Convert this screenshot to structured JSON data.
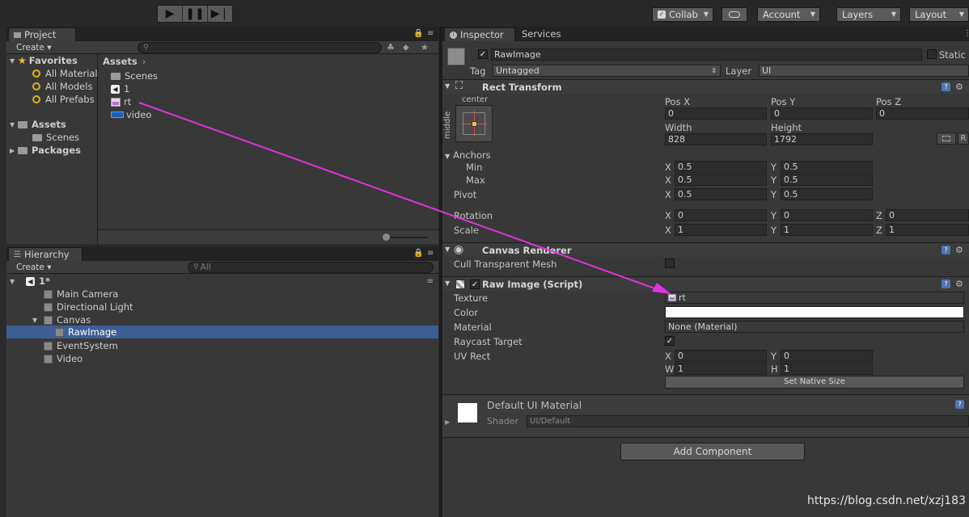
{
  "toolbar": {
    "collab": "Collab",
    "account": "Account",
    "layers": "Layers",
    "layout": "Layout"
  },
  "project": {
    "tab": "Project",
    "create": "Create",
    "favorites": {
      "label": "Favorites",
      "items": [
        "All Material",
        "All Models",
        "All Prefabs"
      ]
    },
    "assets_label": "Assets",
    "assets_child": "Scenes",
    "packages_label": "Packages",
    "breadcrumb": "Assets",
    "files": [
      {
        "name": "Scenes",
        "icon": "folder-icon"
      },
      {
        "name": "1",
        "icon": "unity-scene-icon"
      },
      {
        "name": "rt",
        "icon": "render-texture-icon"
      },
      {
        "name": "video",
        "icon": "video-clip-icon"
      }
    ]
  },
  "hierarchy": {
    "tab": "Hierarchy",
    "create": "Create",
    "search_placeholder": "All",
    "scene": "1*",
    "items": [
      {
        "name": "Main Camera",
        "indent": 1,
        "selected": false
      },
      {
        "name": "Directional Light",
        "indent": 1,
        "selected": false
      },
      {
        "name": "Canvas",
        "indent": 1,
        "selected": false,
        "expanded": true
      },
      {
        "name": "RawImage",
        "indent": 2,
        "selected": true
      },
      {
        "name": "EventSystem",
        "indent": 1,
        "selected": false
      },
      {
        "name": "Video",
        "indent": 1,
        "selected": false
      }
    ]
  },
  "inspector": {
    "tab": "Inspector",
    "tab2": "Services",
    "object_name": "RawImage",
    "static": "Static",
    "tag_label": "Tag",
    "tag_value": "Untagged",
    "layer_label": "Layer",
    "layer_value": "UI",
    "rect_transform": {
      "title": "Rect Transform",
      "anchor_top": "center",
      "anchor_side": "middle",
      "pos_x_label": "Pos X",
      "pos_x": "0",
      "pos_y_label": "Pos Y",
      "pos_y": "0",
      "pos_z_label": "Pos Z",
      "pos_z": "0",
      "width_label": "Width",
      "width": "828",
      "height_label": "Height",
      "height": "1792",
      "anchors": "Anchors",
      "min": "Min",
      "min_x": "0.5",
      "min_y": "0.5",
      "max": "Max",
      "max_x": "0.5",
      "max_y": "0.5",
      "pivot": "Pivot",
      "pivot_x": "0.5",
      "pivot_y": "0.5",
      "rotation": "Rotation",
      "rot_x": "0",
      "rot_y": "0",
      "rot_z": "0",
      "scale": "Scale",
      "scale_x": "1",
      "scale_y": "1",
      "scale_z": "1",
      "x": "X",
      "y": "Y",
      "z": "Z",
      "r": "R"
    },
    "canvas_renderer": {
      "title": "Canvas Renderer",
      "cull": "Cull Transparent Mesh"
    },
    "raw_image": {
      "title": "Raw Image (Script)",
      "texture_label": "Texture",
      "texture": "rt",
      "color_label": "Color",
      "material_label": "Material",
      "material": "None (Material)",
      "raycast_label": "Raycast Target",
      "uvrect_label": "UV Rect",
      "uv_x": "0",
      "uv_y": "0",
      "uv_w": "1",
      "uv_h": "1",
      "w": "W",
      "h": "H",
      "set_native": "Set Native Size"
    },
    "material_block": {
      "title": "Default UI Material",
      "shader_label": "Shader",
      "shader": "UI/Default"
    },
    "add_component": "Add Component"
  },
  "watermark": "https://blog.csdn.net/xzj183",
  "colors": {
    "selection": "#3e5f96",
    "arrow": "#e033e0",
    "panel": "#383838"
  }
}
